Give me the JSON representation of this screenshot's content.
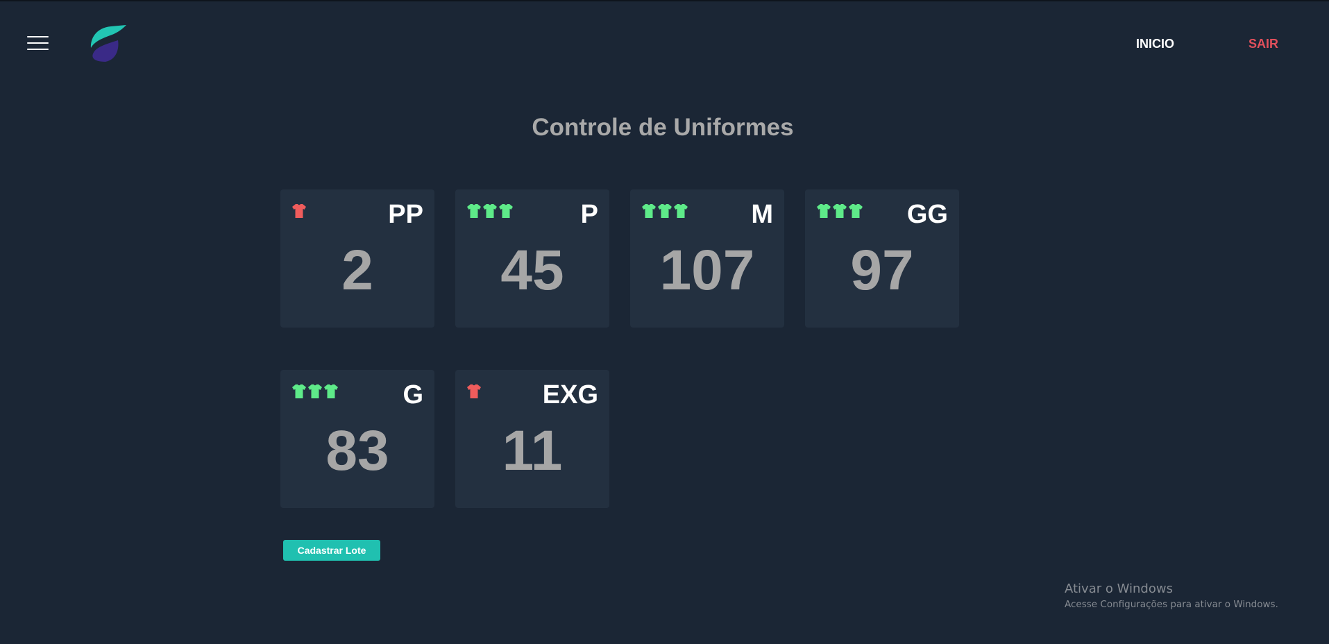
{
  "header": {
    "menu_icon": "hamburger-menu-icon",
    "logo_icon": "app-logo",
    "nav": {
      "inicio_label": "INICIO",
      "sair_label": "SAIR"
    },
    "colors": {
      "inicio": "#ffffff",
      "sair": "#e2505c"
    }
  },
  "page": {
    "title": "Controle de Uniformes"
  },
  "stock": {
    "cards": [
      {
        "size": "PP",
        "value": "2",
        "shirts": 1,
        "status": "low"
      },
      {
        "size": "P",
        "value": "45",
        "shirts": 3,
        "status": "ok"
      },
      {
        "size": "M",
        "value": "107",
        "shirts": 3,
        "status": "ok"
      },
      {
        "size": "GG",
        "value": "97",
        "shirts": 3,
        "status": "ok"
      },
      {
        "size": "G",
        "value": "83",
        "shirts": 3,
        "status": "ok"
      },
      {
        "size": "EXG",
        "value": "11",
        "shirts": 1,
        "status": "low"
      }
    ],
    "icon": "tshirt-icon",
    "colors": {
      "low": "#ef5c5c",
      "ok": "#5eea89",
      "card_bg": "#233040",
      "value": "#a6a6a6"
    }
  },
  "actions": {
    "register_batch_label": "Cadastrar Lote",
    "register_batch_color": "#20c0b0"
  },
  "windows_watermark": {
    "title": "Ativar o Windows",
    "subtitle": "Acesse Configurações para ativar o Windows."
  }
}
